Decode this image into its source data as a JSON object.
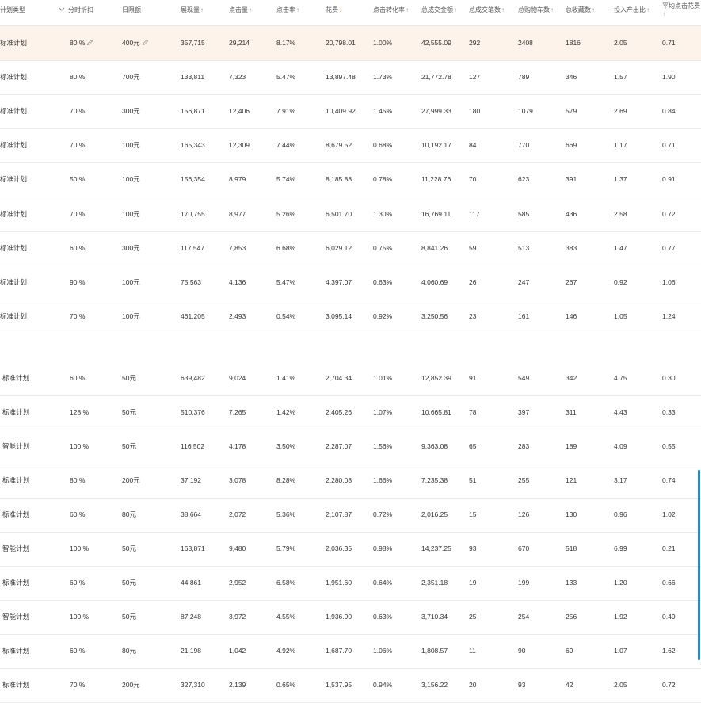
{
  "header": {
    "col_type": "计划类型",
    "col_discount": "分时折扣",
    "col_budget": "日限额",
    "col_impressions": "展现量",
    "col_clicks": "点击量",
    "col_ctr": "点击率",
    "col_spend": "花费",
    "col_cvr": "点击转化率",
    "col_gmv": "总成交金额",
    "col_orders": "总成交笔数",
    "col_cart": "总购物车数",
    "col_fav": "总收藏数",
    "col_roi": "投入产出比",
    "col_cpc": "平均点击花费",
    "arrow_up": "↑",
    "arrow_down": "↓"
  },
  "rows": [
    {
      "type": "标准计划",
      "discount": "80 %",
      "budget": "400元",
      "impressions": "357,715",
      "clicks": "29,214",
      "ctr": "8.17%",
      "spend": "20,798.01",
      "cvr": "1.00%",
      "gmv": "42,555.09",
      "orders": "292",
      "cart": "2408",
      "fav": "1816",
      "roi": "2.05",
      "cpc": "0.71"
    },
    {
      "type": "标准计划",
      "discount": "80 %",
      "budget": "700元",
      "impressions": "133,811",
      "clicks": "7,323",
      "ctr": "5.47%",
      "spend": "13,897.48",
      "cvr": "1.73%",
      "gmv": "21,772.78",
      "orders": "127",
      "cart": "789",
      "fav": "346",
      "roi": "1.57",
      "cpc": "1.90"
    },
    {
      "type": "标准计划",
      "discount": "70 %",
      "budget": "300元",
      "impressions": "156,871",
      "clicks": "12,406",
      "ctr": "7.91%",
      "spend": "10,409.92",
      "cvr": "1.45%",
      "gmv": "27,999.33",
      "orders": "180",
      "cart": "1079",
      "fav": "579",
      "roi": "2.69",
      "cpc": "0.84"
    },
    {
      "type": "标准计划",
      "discount": "70 %",
      "budget": "100元",
      "impressions": "165,343",
      "clicks": "12,309",
      "ctr": "7.44%",
      "spend": "8,679.52",
      "cvr": "0.68%",
      "gmv": "10,192.17",
      "orders": "84",
      "cart": "770",
      "fav": "669",
      "roi": "1.17",
      "cpc": "0.71"
    },
    {
      "type": "标准计划",
      "discount": "50 %",
      "budget": "100元",
      "impressions": "156,354",
      "clicks": "8,979",
      "ctr": "5.74%",
      "spend": "8,185.88",
      "cvr": "0.78%",
      "gmv": "11,228.76",
      "orders": "70",
      "cart": "623",
      "fav": "391",
      "roi": "1.37",
      "cpc": "0.91"
    },
    {
      "type": "标准计划",
      "discount": "70 %",
      "budget": "100元",
      "impressions": "170,755",
      "clicks": "8,977",
      "ctr": "5.26%",
      "spend": "6,501.70",
      "cvr": "1.30%",
      "gmv": "16,769.11",
      "orders": "117",
      "cart": "585",
      "fav": "436",
      "roi": "2.58",
      "cpc": "0.72"
    },
    {
      "type": "标准计划",
      "discount": "60 %",
      "budget": "300元",
      "impressions": "117,547",
      "clicks": "7,853",
      "ctr": "6.68%",
      "spend": "6,029.12",
      "cvr": "0.75%",
      "gmv": "8,841.26",
      "orders": "59",
      "cart": "513",
      "fav": "383",
      "roi": "1.47",
      "cpc": "0.77"
    },
    {
      "type": "标准计划",
      "discount": "90 %",
      "budget": "100元",
      "impressions": "75,563",
      "clicks": "4,136",
      "ctr": "5.47%",
      "spend": "4,397.07",
      "cvr": "0.63%",
      "gmv": "4,060.69",
      "orders": "26",
      "cart": "247",
      "fav": "267",
      "roi": "0.92",
      "cpc": "1.06"
    },
    {
      "type": "标准计划",
      "discount": "70 %",
      "budget": "100元",
      "impressions": "461,205",
      "clicks": "2,493",
      "ctr": "0.54%",
      "spend": "3,095.14",
      "cvr": "0.92%",
      "gmv": "3,250.56",
      "orders": "23",
      "cart": "161",
      "fav": "146",
      "roi": "1.05",
      "cpc": "1.24"
    },
    {
      "type": "标准计划",
      "discount": "60 %",
      "budget": "50元",
      "impressions": "639,482",
      "clicks": "9,024",
      "ctr": "1.41%",
      "spend": "2,704.34",
      "cvr": "1.01%",
      "gmv": "12,852.39",
      "orders": "91",
      "cart": "549",
      "fav": "342",
      "roi": "4.75",
      "cpc": "0.30"
    },
    {
      "type": "标准计划",
      "discount": "128 %",
      "budget": "50元",
      "impressions": "510,376",
      "clicks": "7,265",
      "ctr": "1.42%",
      "spend": "2,405.26",
      "cvr": "1.07%",
      "gmv": "10,665.81",
      "orders": "78",
      "cart": "397",
      "fav": "311",
      "roi": "4.43",
      "cpc": "0.33"
    },
    {
      "type": "智能计划",
      "discount": "100 %",
      "budget": "50元",
      "impressions": "116,502",
      "clicks": "4,178",
      "ctr": "3.50%",
      "spend": "2,287.07",
      "cvr": "1.56%",
      "gmv": "9,363.08",
      "orders": "65",
      "cart": "283",
      "fav": "189",
      "roi": "4.09",
      "cpc": "0.55"
    },
    {
      "type": "标准计划",
      "discount": "80 %",
      "budget": "200元",
      "impressions": "37,192",
      "clicks": "3,078",
      "ctr": "8.28%",
      "spend": "2,280.08",
      "cvr": "1.66%",
      "gmv": "7,235.38",
      "orders": "51",
      "cart": "255",
      "fav": "121",
      "roi": "3.17",
      "cpc": "0.74"
    },
    {
      "type": "标准计划",
      "discount": "60 %",
      "budget": "80元",
      "impressions": "38,664",
      "clicks": "2,072",
      "ctr": "5.36%",
      "spend": "2,107.87",
      "cvr": "0.72%",
      "gmv": "2,016.25",
      "orders": "15",
      "cart": "126",
      "fav": "130",
      "roi": "0.96",
      "cpc": "1.02"
    },
    {
      "type": "智能计划",
      "discount": "100 %",
      "budget": "50元",
      "impressions": "163,871",
      "clicks": "9,480",
      "ctr": "5.79%",
      "spend": "2,036.35",
      "cvr": "0.98%",
      "gmv": "14,237.25",
      "orders": "93",
      "cart": "670",
      "fav": "518",
      "roi": "6.99",
      "cpc": "0.21"
    },
    {
      "type": "标准计划",
      "discount": "60 %",
      "budget": "50元",
      "impressions": "44,861",
      "clicks": "2,952",
      "ctr": "6.58%",
      "spend": "1,951.60",
      "cvr": "0.64%",
      "gmv": "2,351.18",
      "orders": "19",
      "cart": "199",
      "fav": "133",
      "roi": "1.20",
      "cpc": "0.66"
    },
    {
      "type": "智能计划",
      "discount": "100 %",
      "budget": "50元",
      "impressions": "87,248",
      "clicks": "3,972",
      "ctr": "4.55%",
      "spend": "1,936.90",
      "cvr": "0.63%",
      "gmv": "3,710.34",
      "orders": "25",
      "cart": "254",
      "fav": "256",
      "roi": "1.92",
      "cpc": "0.49"
    },
    {
      "type": "标准计划",
      "discount": "60 %",
      "budget": "80元",
      "impressions": "21,198",
      "clicks": "1,042",
      "ctr": "4.92%",
      "spend": "1,687.70",
      "cvr": "1.06%",
      "gmv": "1,808.57",
      "orders": "11",
      "cart": "90",
      "fav": "69",
      "roi": "1.07",
      "cpc": "1.62"
    },
    {
      "type": "标准计划",
      "discount": "70 %",
      "budget": "200元",
      "impressions": "327,310",
      "clicks": "2,139",
      "ctr": "0.65%",
      "spend": "1,537.95",
      "cvr": "0.94%",
      "gmv": "3,156.22",
      "orders": "20",
      "cart": "93",
      "fav": "42",
      "roi": "2.05",
      "cpc": "0.72"
    }
  ],
  "colors": {
    "highlight_row": "#fdf3ea",
    "sort_active": "#f08a3c",
    "scrollbar": "#1a8fe3"
  }
}
